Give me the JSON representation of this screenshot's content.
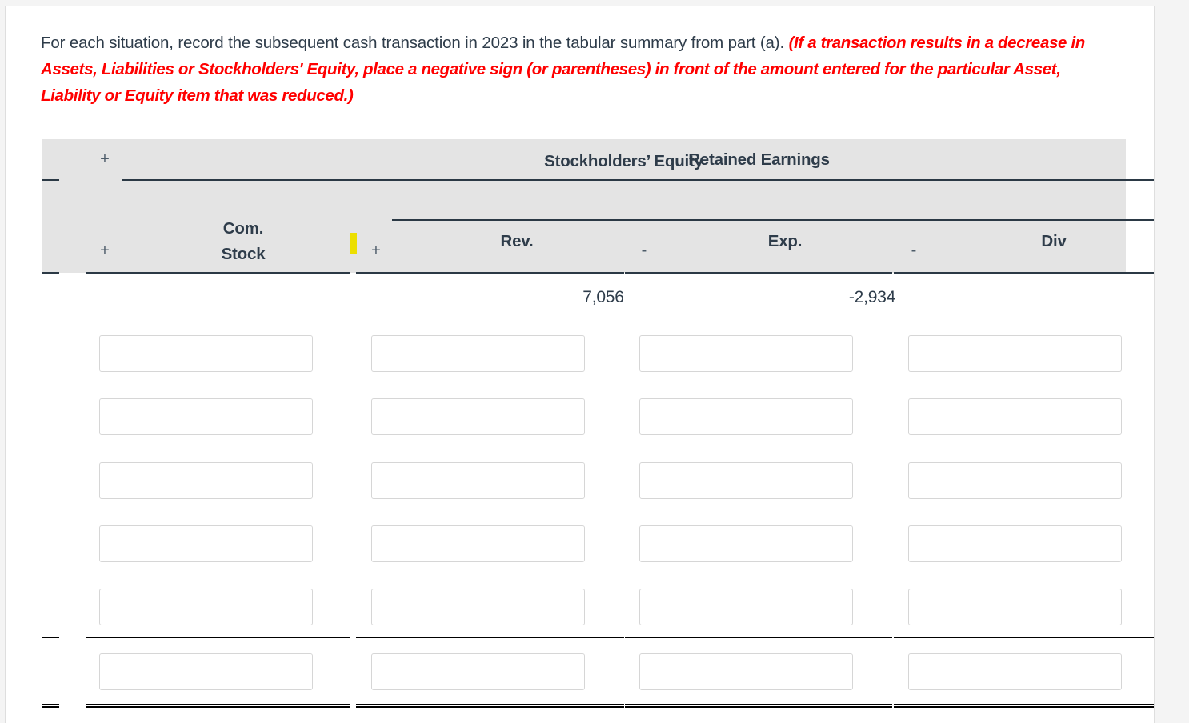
{
  "instructions": {
    "lead": "For each situation, record the subsequent cash transaction in 2023 in the tabular summary from part (a). ",
    "emphasis": "(If a transaction results in a decrease in Assets, Liabilities or Stockholders' Equity, place a negative sign (or parentheses) in front of the amount entered for the particular Asset, Liability or Equity item that was reduced.)"
  },
  "table": {
    "group_header": "Stockholders’ Equity",
    "subgroup_header": "Retained Earnings",
    "operators": {
      "top": "+",
      "before_stock": "+",
      "before_rev": "+",
      "before_exp": "-",
      "before_div": "-",
      "subtotal_mark": "-",
      "total_mark": "="
    },
    "columns": [
      {
        "id": "stock",
        "label_line1": "Com.",
        "label_line2": "Stock"
      },
      {
        "id": "rev",
        "label_line1": "Rev.",
        "label_line2": ""
      },
      {
        "id": "exp",
        "label_line1": "Exp.",
        "label_line2": ""
      },
      {
        "id": "div",
        "label_line1": "Div",
        "label_line2": ""
      }
    ],
    "balance_row": {
      "stock": "",
      "rev": "7,056",
      "exp": "-2,934",
      "div": ""
    },
    "entry_rows": [
      {
        "stock": "",
        "rev": "",
        "exp": "",
        "div": ""
      },
      {
        "stock": "",
        "rev": "",
        "exp": "",
        "div": ""
      },
      {
        "stock": "",
        "rev": "",
        "exp": "",
        "div": ""
      },
      {
        "stock": "",
        "rev": "",
        "exp": "",
        "div": ""
      },
      {
        "stock": "",
        "rev": "",
        "exp": "",
        "div": ""
      },
      {
        "stock": "",
        "rev": "",
        "exp": "",
        "div": ""
      }
    ],
    "input_placeholder": ""
  },
  "colors": {
    "text": "#2e3c4a",
    "emphasis": "#ff0000",
    "header_bg": "#e4e4e4",
    "rule": "#2b3945",
    "highlight": "#ecdf00"
  }
}
